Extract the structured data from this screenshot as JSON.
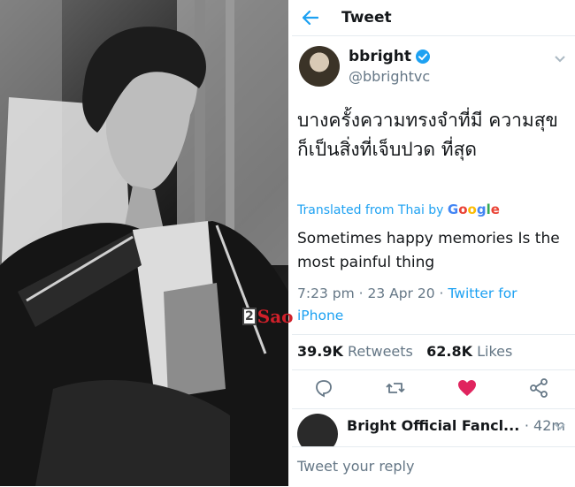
{
  "photo": {
    "alt": "black and white portrait photo"
  },
  "header": {
    "title": "Tweet",
    "back_icon": "arrow-left-icon"
  },
  "tweet": {
    "display_name": "bbright",
    "handle": "@bbrightvc",
    "thai_text": "บางครั้งความทรงจำที่มี ความสุข ก็เป็นสิ่งที่เจ็บปวด ที่สุด",
    "translated_prefix": "Translated from Thai by",
    "translated_brand": "Google",
    "translation": "Sometimes happy memories Is the most painful thing",
    "time": "7:23 pm",
    "date": "23 Apr 20",
    "source": "Twitter for iPhone",
    "retweets_count": "39.9K",
    "retweets_label": "Retweets",
    "likes_count": "62.8K",
    "likes_label": "Likes"
  },
  "reply": {
    "name": "Bright Official Fancl...",
    "time": "42m"
  },
  "composer": {
    "placeholder": "Tweet your reply"
  },
  "watermark": {
    "badge": "2",
    "text": "Sao"
  },
  "colors": {
    "accent": "#1da1f2",
    "like": "#e0245e",
    "text": "#14171a",
    "muted": "#657786"
  }
}
